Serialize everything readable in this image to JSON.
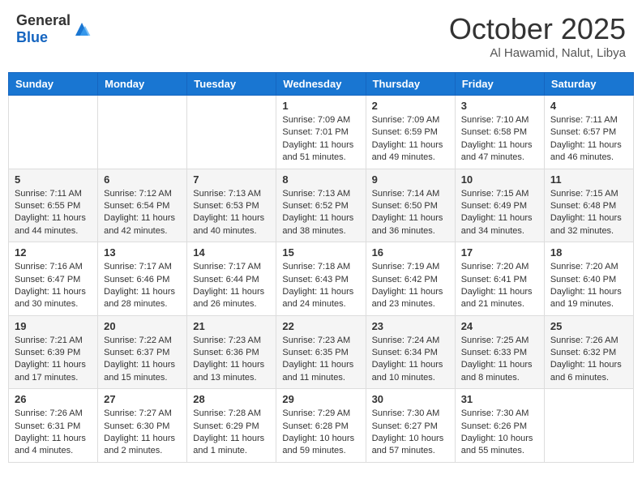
{
  "header": {
    "logo_general": "General",
    "logo_blue": "Blue",
    "title": "October 2025",
    "location": "Al Hawamid, Nalut, Libya"
  },
  "weekdays": [
    "Sunday",
    "Monday",
    "Tuesday",
    "Wednesday",
    "Thursday",
    "Friday",
    "Saturday"
  ],
  "weeks": [
    [
      {
        "day": "",
        "info": ""
      },
      {
        "day": "",
        "info": ""
      },
      {
        "day": "",
        "info": ""
      },
      {
        "day": "1",
        "info": "Sunrise: 7:09 AM\nSunset: 7:01 PM\nDaylight: 11 hours and 51 minutes."
      },
      {
        "day": "2",
        "info": "Sunrise: 7:09 AM\nSunset: 6:59 PM\nDaylight: 11 hours and 49 minutes."
      },
      {
        "day": "3",
        "info": "Sunrise: 7:10 AM\nSunset: 6:58 PM\nDaylight: 11 hours and 47 minutes."
      },
      {
        "day": "4",
        "info": "Sunrise: 7:11 AM\nSunset: 6:57 PM\nDaylight: 11 hours and 46 minutes."
      }
    ],
    [
      {
        "day": "5",
        "info": "Sunrise: 7:11 AM\nSunset: 6:55 PM\nDaylight: 11 hours and 44 minutes."
      },
      {
        "day": "6",
        "info": "Sunrise: 7:12 AM\nSunset: 6:54 PM\nDaylight: 11 hours and 42 minutes."
      },
      {
        "day": "7",
        "info": "Sunrise: 7:13 AM\nSunset: 6:53 PM\nDaylight: 11 hours and 40 minutes."
      },
      {
        "day": "8",
        "info": "Sunrise: 7:13 AM\nSunset: 6:52 PM\nDaylight: 11 hours and 38 minutes."
      },
      {
        "day": "9",
        "info": "Sunrise: 7:14 AM\nSunset: 6:50 PM\nDaylight: 11 hours and 36 minutes."
      },
      {
        "day": "10",
        "info": "Sunrise: 7:15 AM\nSunset: 6:49 PM\nDaylight: 11 hours and 34 minutes."
      },
      {
        "day": "11",
        "info": "Sunrise: 7:15 AM\nSunset: 6:48 PM\nDaylight: 11 hours and 32 minutes."
      }
    ],
    [
      {
        "day": "12",
        "info": "Sunrise: 7:16 AM\nSunset: 6:47 PM\nDaylight: 11 hours and 30 minutes."
      },
      {
        "day": "13",
        "info": "Sunrise: 7:17 AM\nSunset: 6:46 PM\nDaylight: 11 hours and 28 minutes."
      },
      {
        "day": "14",
        "info": "Sunrise: 7:17 AM\nSunset: 6:44 PM\nDaylight: 11 hours and 26 minutes."
      },
      {
        "day": "15",
        "info": "Sunrise: 7:18 AM\nSunset: 6:43 PM\nDaylight: 11 hours and 24 minutes."
      },
      {
        "day": "16",
        "info": "Sunrise: 7:19 AM\nSunset: 6:42 PM\nDaylight: 11 hours and 23 minutes."
      },
      {
        "day": "17",
        "info": "Sunrise: 7:20 AM\nSunset: 6:41 PM\nDaylight: 11 hours and 21 minutes."
      },
      {
        "day": "18",
        "info": "Sunrise: 7:20 AM\nSunset: 6:40 PM\nDaylight: 11 hours and 19 minutes."
      }
    ],
    [
      {
        "day": "19",
        "info": "Sunrise: 7:21 AM\nSunset: 6:39 PM\nDaylight: 11 hours and 17 minutes."
      },
      {
        "day": "20",
        "info": "Sunrise: 7:22 AM\nSunset: 6:37 PM\nDaylight: 11 hours and 15 minutes."
      },
      {
        "day": "21",
        "info": "Sunrise: 7:23 AM\nSunset: 6:36 PM\nDaylight: 11 hours and 13 minutes."
      },
      {
        "day": "22",
        "info": "Sunrise: 7:23 AM\nSunset: 6:35 PM\nDaylight: 11 hours and 11 minutes."
      },
      {
        "day": "23",
        "info": "Sunrise: 7:24 AM\nSunset: 6:34 PM\nDaylight: 11 hours and 10 minutes."
      },
      {
        "day": "24",
        "info": "Sunrise: 7:25 AM\nSunset: 6:33 PM\nDaylight: 11 hours and 8 minutes."
      },
      {
        "day": "25",
        "info": "Sunrise: 7:26 AM\nSunset: 6:32 PM\nDaylight: 11 hours and 6 minutes."
      }
    ],
    [
      {
        "day": "26",
        "info": "Sunrise: 7:26 AM\nSunset: 6:31 PM\nDaylight: 11 hours and 4 minutes."
      },
      {
        "day": "27",
        "info": "Sunrise: 7:27 AM\nSunset: 6:30 PM\nDaylight: 11 hours and 2 minutes."
      },
      {
        "day": "28",
        "info": "Sunrise: 7:28 AM\nSunset: 6:29 PM\nDaylight: 11 hours and 1 minute."
      },
      {
        "day": "29",
        "info": "Sunrise: 7:29 AM\nSunset: 6:28 PM\nDaylight: 10 hours and 59 minutes."
      },
      {
        "day": "30",
        "info": "Sunrise: 7:30 AM\nSunset: 6:27 PM\nDaylight: 10 hours and 57 minutes."
      },
      {
        "day": "31",
        "info": "Sunrise: 7:30 AM\nSunset: 6:26 PM\nDaylight: 10 hours and 55 minutes."
      },
      {
        "day": "",
        "info": ""
      }
    ]
  ]
}
